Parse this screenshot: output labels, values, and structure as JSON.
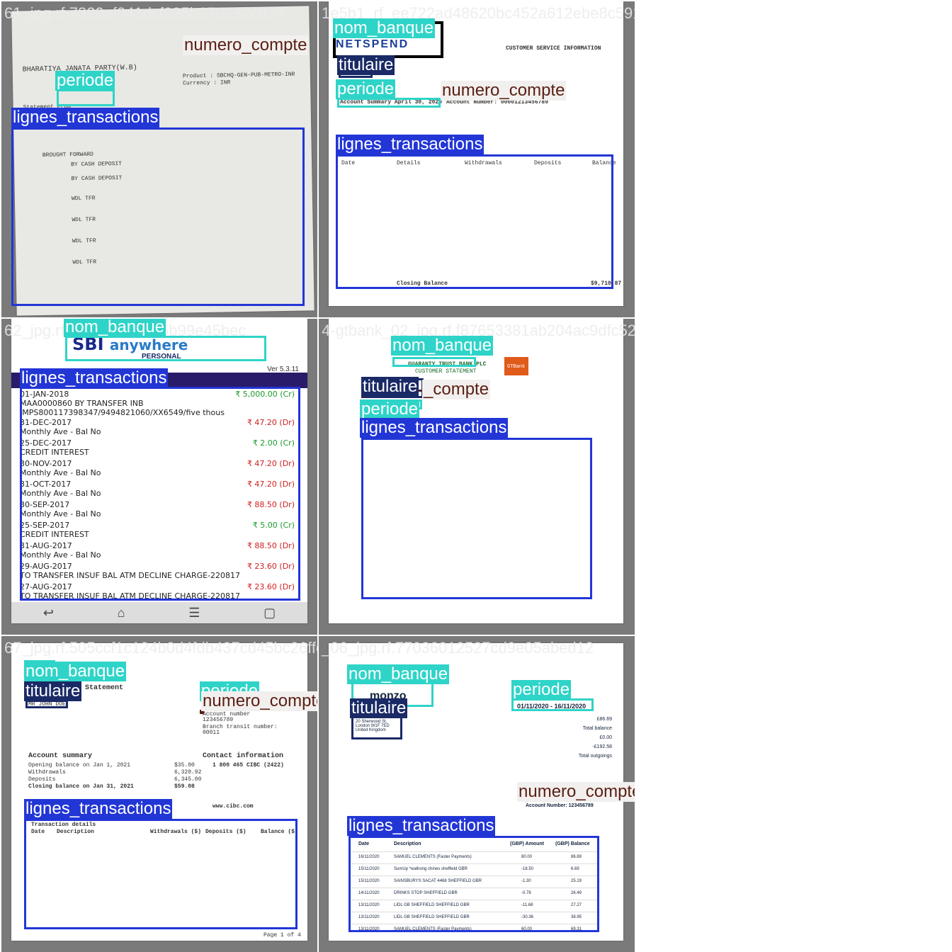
{
  "tiles": [
    {
      "filename": "61_jpg.rf.7320af041dcf985b270232cd78",
      "labels": {
        "periode": "periode",
        "numero_compte": "numero_compte",
        "lignes_transactions": "lignes_transactions"
      },
      "doc_text": [
        "BHARATIYA JANATA PARTY(W.B)",
        "Statement From",
        "Product : SBCHQ-GEN-PUB-METRO-INR",
        "Currency : INR",
        "BROUGHT FORWARD",
        "BY CASH DEPOSIT",
        "BY CASH DEPOSIT",
        "WDL TFR",
        "WDL TFR",
        "WDL TFR",
        "WDL TFR"
      ]
    },
    {
      "filename": "1e5b1_rf_ee722ad48620bc452a612ebe8c591a",
      "labels": {
        "nom_banque": "nom_banque",
        "titulaire": "titulaire",
        "periode": "periode",
        "numero_compte": "numero_compte",
        "lignes_transactions": "lignes_transactions"
      },
      "doc_text": [
        "NETSPEND",
        "CUSTOMER SERVICE INFORMATION",
        "Account Summary April 30, 2020",
        "Account Number: 00001213456789",
        "Date",
        "Details",
        "Withdrawals",
        "Deposits",
        "Balance",
        "Closing Balance",
        "$9,710.87"
      ]
    },
    {
      "filename": "62_jpg.rf.823919bf2265b99e45bec",
      "labels": {
        "nom_banque": "nom_banque",
        "lignes_transactions": "lignes_transactions"
      },
      "brand": {
        "sbi": "SBI",
        "anywhere": "anywhere",
        "personal": "PERSONAL",
        "version": "Ver 5.3.11"
      },
      "rows": [
        {
          "date": "01-JAN-2018",
          "amount": "₹ 5,000.00 (Cr)",
          "desc": "MAA0000860    BY TRANSFER INB",
          "desc2": "IMPS800117398347/9494821060/XX6549/five thous",
          "type": "cr"
        },
        {
          "date": "31-DEC-2017",
          "amount": "₹ 47.20 (Dr)",
          "desc": "Monthly Ave - Bal No",
          "type": "dr"
        },
        {
          "date": "25-DEC-2017",
          "amount": "₹ 2.00 (Cr)",
          "desc": "CREDIT INTEREST",
          "type": "cr"
        },
        {
          "date": "30-NOV-2017",
          "amount": "₹ 47.20 (Dr)",
          "desc": "Monthly Ave - Bal No",
          "type": "dr"
        },
        {
          "date": "31-OCT-2017",
          "amount": "₹ 47.20 (Dr)",
          "desc": "Monthly Ave - Bal No",
          "type": "dr"
        },
        {
          "date": "30-SEP-2017",
          "amount": "₹ 88.50 (Dr)",
          "desc": "Monthly Ave - Bal No",
          "type": "dr"
        },
        {
          "date": "25-SEP-2017",
          "amount": "₹ 5.00 (Cr)",
          "desc": "CREDIT INTEREST",
          "type": "cr"
        },
        {
          "date": "31-AUG-2017",
          "amount": "₹ 88.50 (Dr)",
          "desc": "Monthly Ave - Bal No",
          "type": "dr"
        },
        {
          "date": "29-AUG-2017",
          "amount": "₹ 23.60 (Dr)",
          "desc": "TO TRANSFER INSUF BAL ATM DECLINE CHARGE-220817",
          "type": "dr"
        },
        {
          "date": "27-AUG-2017",
          "amount": "₹ 23.60 (Dr)",
          "desc": "TO TRANSFER INSUF BAL ATM DECLINE CHARGE-220817",
          "type": "dr"
        }
      ]
    },
    {
      "filename": "4-gtbank_02_jpg.rf.f87653381ab204ac9dfc526",
      "labels": {
        "nom_banque": "nom_banque",
        "titulaire": "titulaire",
        "numero_compte": "_compte",
        "periode": "periode",
        "lignes_transactions": "lignes_transactions"
      },
      "doc_text": [
        "GUARANTY TRUST BANK PLC",
        "CUSTOMER STATEMENT",
        "GTBank"
      ]
    },
    {
      "filename": "67_jpg.rf.505ccf1c124b0d4fdb437cd45bc26ffe",
      "labels": {
        "nom_banque": "nom_banque",
        "titulaire": "titulaire",
        "periode": "periode",
        "numero_compte": "numero_compte",
        "lignes_transactions": "lignes_transactions"
      },
      "doc_text": [
        "Statement",
        "MR JOHN DOE",
        "Account number",
        "123456789",
        "Branch transit number:",
        "00011",
        "Account summary",
        "Opening balance on Jan 1, 2021",
        "$35.00",
        "Withdrawals",
        "6,320.92",
        "Deposits",
        "6,345.00",
        "Closing balance on Jan 31, 2021",
        "$59.08",
        "Contact information",
        "1 800 465 CIBC (2422)",
        "www.cibc.com",
        "Transaction details",
        "Date",
        "Description",
        "Withdrawals ($)",
        "Deposits ($)",
        "Balance ($)",
        "Page 1 of 4"
      ]
    },
    {
      "filename": "_06_jpg.rf.77036012527cd9e05abed12",
      "labels": {
        "nom_banque": "nom_banque",
        "titulaire": "titulaire",
        "periode": "periode",
        "numero_compte": "numero_compte",
        "lignes_transactions": "lignes_transactions"
      },
      "brand": "monzo",
      "holder": [
        "Mr John Doe",
        "20 Sherwood St,",
        "London W1F 7ED",
        "United Kingdom"
      ],
      "period": "01/11/2020 - 16/11/2020",
      "account": "Account Number: 123456789",
      "totals": [
        "£86.69",
        "Total balance",
        "£0.00",
        "-£192.58",
        "Total outgoings"
      ],
      "headers": [
        "Date",
        "Description",
        "(GBP) Amount",
        "(GBP) Balance"
      ],
      "rows": [
        {
          "date": "16/11/2020",
          "desc": "SAMUEL CLEMENTS (Faster Payments)",
          "amt": "80.00",
          "bal": "86.69"
        },
        {
          "date": "15/11/2020",
          "desc": "SumUp *walhong chines sheffield GBR",
          "amt": "-18.50",
          "bal": "6.69"
        },
        {
          "date": "15/11/2020",
          "desc": "SAINSBURYS SACAT 4468 SHEFFIELD GBR",
          "amt": "-1.30",
          "bal": "25.19"
        },
        {
          "date": "14/11/2020",
          "desc": "DRINKS STOP SHEFFIELD GBR",
          "amt": "-0.78",
          "bal": "26.49"
        },
        {
          "date": "13/11/2020",
          "desc": "LIDL GB SHEFFIELD SHEFFIELD GBR",
          "amt": "-11.68",
          "bal": "27.27"
        },
        {
          "date": "13/11/2020",
          "desc": "LIDL GB SHEFFIELD SHEFFIELD GBR",
          "amt": "-30.36",
          "bal": "38.95"
        },
        {
          "date": "13/11/2020",
          "desc": "SAMUEL CLEMENTS (Faster Payments)",
          "amt": "60.00",
          "bal": "69.31"
        }
      ]
    }
  ],
  "colors": {
    "cyan": "#2fd4c8",
    "navy": "#1a2a66",
    "brown": "#5a1e14",
    "blue": "#2236d6"
  }
}
